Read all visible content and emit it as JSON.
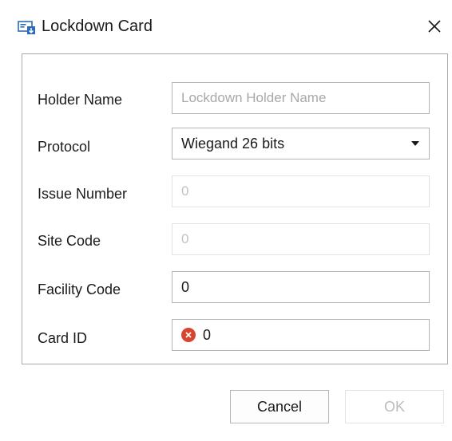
{
  "window": {
    "title": "Lockdown Card",
    "icon": "card-window-icon",
    "close_icon": "close-icon"
  },
  "form": {
    "holder_name": {
      "label": "Holder Name",
      "value": "",
      "placeholder": "Lockdown Holder Name"
    },
    "protocol": {
      "label": "Protocol",
      "value": "Wiegand 26 bits"
    },
    "issue_number": {
      "label": "Issue Number",
      "value": "0",
      "disabled": true
    },
    "site_code": {
      "label": "Site Code",
      "value": "0",
      "disabled": true
    },
    "facility_code": {
      "label": "Facility Code",
      "value": "0"
    },
    "card_id": {
      "label": "Card ID",
      "value": "0",
      "error": true,
      "error_icon": "error-icon"
    }
  },
  "buttons": {
    "cancel": "Cancel",
    "ok": "OK",
    "ok_disabled": true
  },
  "colors": {
    "error": "#d9442f",
    "border": "#b4b4b4",
    "disabled_text": "#c2c2c2"
  }
}
